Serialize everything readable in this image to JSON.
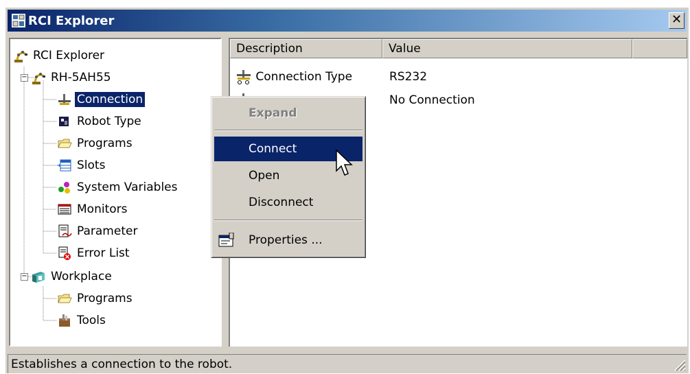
{
  "window": {
    "title": "RCI Explorer",
    "close_glyph": "✕"
  },
  "tree": {
    "root": {
      "label": "RCI Explorer",
      "icon": "robot-arm-icon"
    },
    "robot": {
      "label": "RH-5AH55",
      "icon": "robot-arm-icon",
      "expanded": true
    },
    "robot_children": [
      {
        "label": "Connection",
        "icon": "connection-icon",
        "selected": true
      },
      {
        "label": "Robot Type",
        "icon": "robot-type-icon"
      },
      {
        "label": "Programs",
        "icon": "folder-open-icon"
      },
      {
        "label": "Slots",
        "icon": "slots-icon"
      },
      {
        "label": "System Variables",
        "icon": "variables-icon"
      },
      {
        "label": "Monitors",
        "icon": "monitor-icon"
      },
      {
        "label": "Parameter",
        "icon": "parameter-icon"
      },
      {
        "label": "Error List",
        "icon": "error-list-icon"
      }
    ],
    "workplace": {
      "label": "Workplace",
      "icon": "workplace-icon",
      "expanded": true
    },
    "workplace_children": [
      {
        "label": "Programs",
        "icon": "folder-open-icon"
      },
      {
        "label": "Tools",
        "icon": "tools-icon"
      }
    ]
  },
  "list": {
    "columns": [
      "Description",
      "Value"
    ],
    "rows": [
      {
        "description": "Connection Type",
        "value": "RS232",
        "icon": "connection-type-icon"
      },
      {
        "description": "",
        "value": "No Connection",
        "icon": "connection-state-icon"
      }
    ]
  },
  "context_menu": {
    "items": [
      {
        "label": "Expand",
        "disabled": true
      },
      {
        "label": "Connect",
        "highlighted": true
      },
      {
        "label": "Open"
      },
      {
        "label": "Disconnect"
      },
      {
        "label": "Properties ...",
        "icon": "properties-icon"
      }
    ]
  },
  "status": {
    "text": "Establishes a connection to the robot."
  },
  "colors": {
    "selection": "#0a246a",
    "face": "#d4d0c8"
  }
}
